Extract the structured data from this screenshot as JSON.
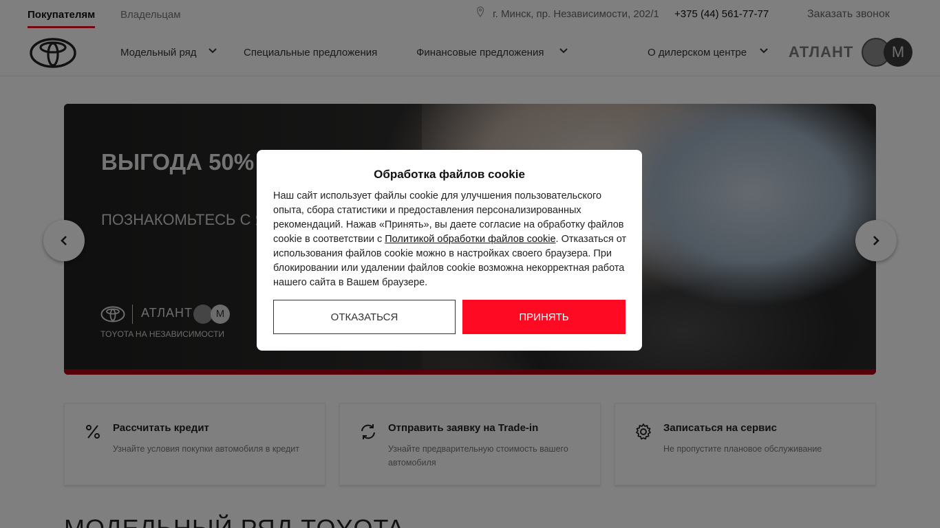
{
  "topbar": {
    "tabs": [
      "Покупателям",
      "Владельцам"
    ],
    "address": "г. Минск, пр. Независимости, 202/1",
    "phone": "+375 (44) 561-77-77",
    "callback": "Заказать звонок"
  },
  "nav": {
    "items": [
      "Модельный ряд",
      "Специальные предложения",
      "Финансовые предложения",
      "О дилерском центре"
    ],
    "dealer_name": "АТЛАНТ",
    "dealer_m": "М"
  },
  "hero": {
    "title": "ВЫГОДА 50% ПОСЕЩЕНИЕ",
    "subtitle": "ПОЗНАКОМЬТЕСЬ С Я КАЧЕСТВОМ СЕРВИСА",
    "brand_name": "АТЛАНТ",
    "brand_m": "М",
    "brand_tagline": "TOYOTA НА НЕЗАВИСИМОСТИ"
  },
  "cards": [
    {
      "title": "Рассчитать кредит",
      "desc": "Узнайте условия покупки автомобиля в кредит",
      "icon": "percent-icon"
    },
    {
      "title": "Отправить заявку на Trade-in",
      "desc": "Узнайте предварительную стоимость вашего автомобиля",
      "icon": "refresh-icon"
    },
    {
      "title": "Записаться на сервис",
      "desc": "Не пропустите плановое обслуживание",
      "icon": "gear-icon"
    }
  ],
  "section_title": "МОДЕЛЬНЫЙ РЯД TOYOTA",
  "cookie": {
    "title": "Обработка файлов cookie",
    "text_before": "Наш сайт использует файлы cookie для улучшения пользовательского опыта, сбора статистики и предоставления персонализированных рекомендаций. Нажав «Принять», вы даете согласие на обработку файлов cookie в соответствии с ",
    "link": "Политикой обработки файлов cookie",
    "text_after": ". Отказаться от использования файлов cookie можно в настройках своего браузера. При блокировании или удалении файлов cookie возможна некорректная работа нашего сайта в Вашем браузере.",
    "decline": "ОТКАЗАТЬСЯ",
    "accept": "ПРИНЯТЬ"
  },
  "colors": {
    "accent": "#eb0a1e",
    "accept_button": "#ff0a22",
    "hero_bar": "#b00015"
  }
}
